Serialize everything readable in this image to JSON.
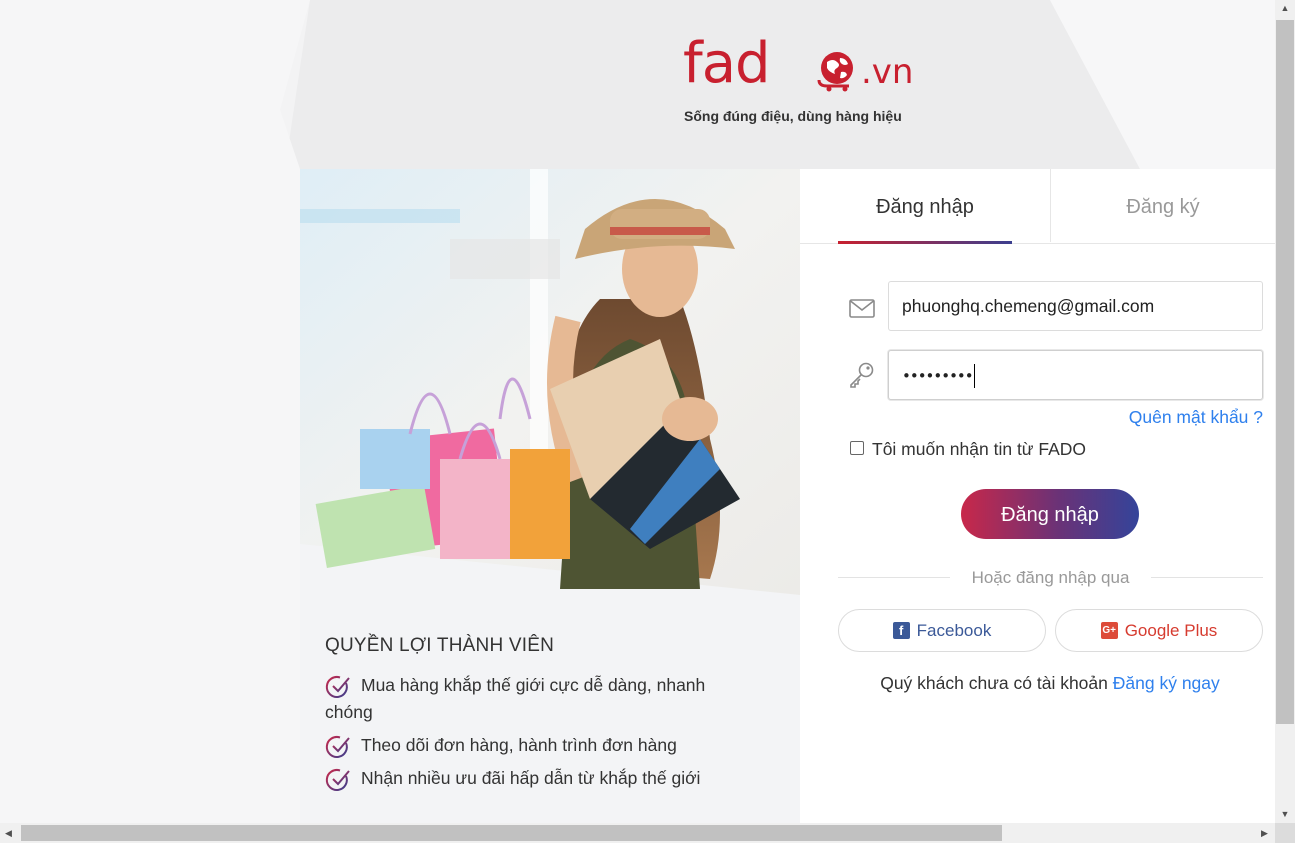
{
  "logo": {
    "brand": "fad",
    "tld": ".vn",
    "tagline": "Sống đúng điệu, dùng hàng hiệu",
    "color": "#c8202f"
  },
  "benefits": {
    "title": "QUYỀN LỢI THÀNH VIÊN",
    "items": [
      "Mua hàng khắp thế giới cực dễ dàng, nhanh",
      "Theo dõi đơn hàng, hành trình đơn hàng",
      "Nhận nhiều ưu đãi hấp dẫn từ khắp thế giới"
    ],
    "item1_wrap": "chóng"
  },
  "tabs": {
    "login": "Đăng nhập",
    "register": "Đăng ký"
  },
  "form": {
    "email_value": "phuonghq.chemeng@gmail.com",
    "password_value": "•••••••••",
    "forgot": "Quên mật khẩu ?",
    "subscribe": "Tôi muốn nhận tin từ FADO",
    "submit": "Đăng nhập",
    "or": "Hoặc đăng nhập qua",
    "facebook": "Facebook",
    "google": "Google Plus",
    "no_account": "Quý khách chưa có tài khoản",
    "signup_now": "Đăng ký ngay"
  },
  "icons": {
    "email": "envelope-icon",
    "password": "key-icon",
    "check": "check-circle-icon",
    "facebook": "facebook-icon",
    "google": "google-plus-icon"
  },
  "colors": {
    "accent": "#c8202f",
    "link": "#2f80ed",
    "gradient_start": "#c8284a",
    "gradient_end": "#34449a"
  }
}
